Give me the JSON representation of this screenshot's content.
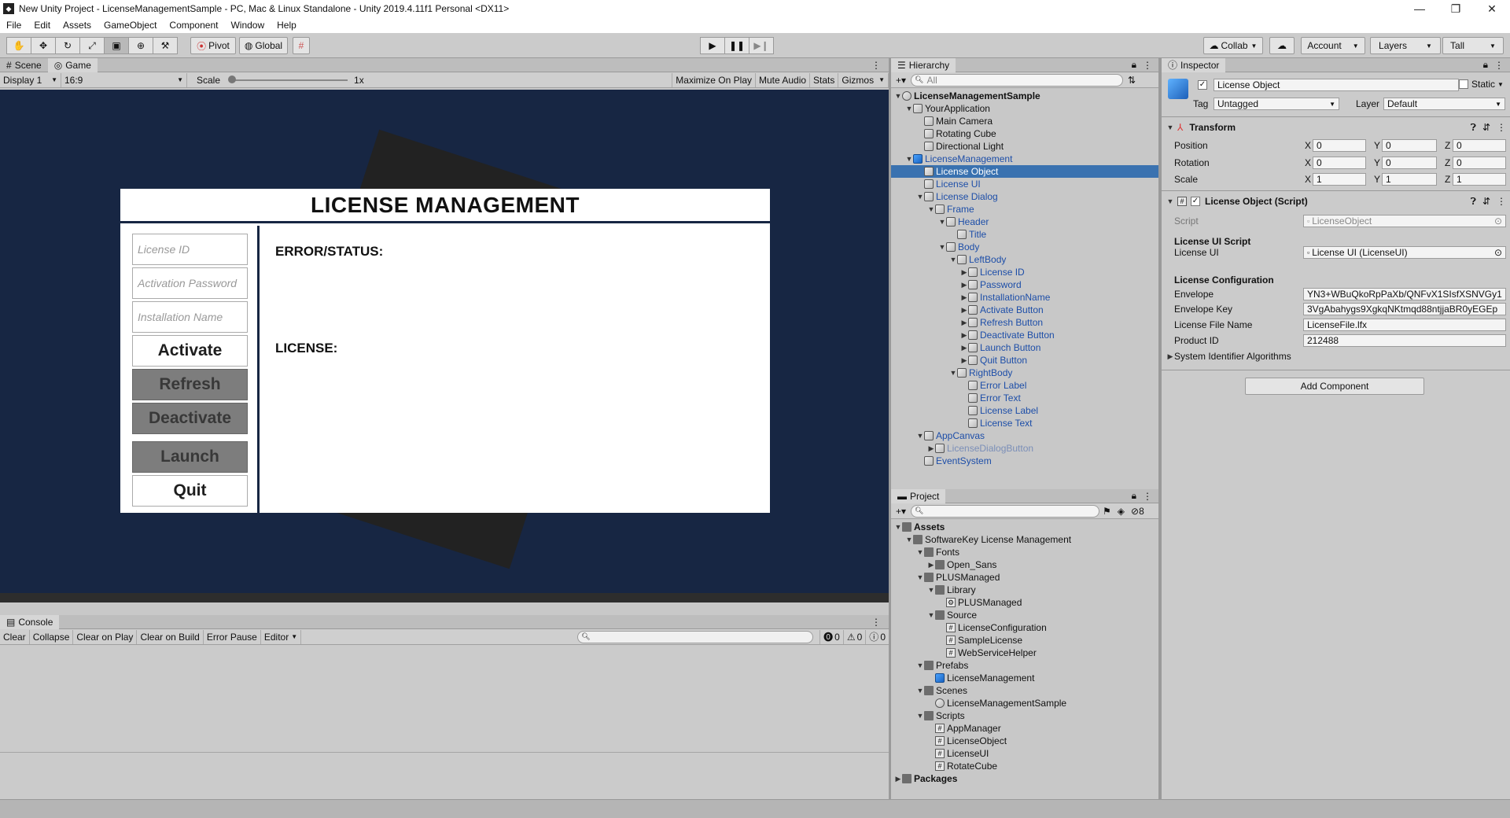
{
  "window": {
    "title": "New Unity Project - LicenseManagementSample - PC, Mac & Linux Standalone - Unity 2019.4.11f1 Personal <DX11>"
  },
  "menu": [
    "File",
    "Edit",
    "Assets",
    "GameObject",
    "Component",
    "Window",
    "Help"
  ],
  "toolbar": {
    "pivot": "Pivot",
    "global": "Global",
    "collab": "Collab",
    "account": "Account",
    "layers": "Layers",
    "layout": "Tall"
  },
  "scene_tabs": {
    "scene": "Scene",
    "game": "Game"
  },
  "game_bar": {
    "display": "Display 1",
    "aspect": "16:9",
    "scale_label": "Scale",
    "scale_value": "1x",
    "maximize": "Maximize On Play",
    "mute": "Mute Audio",
    "stats": "Stats",
    "gizmos": "Gizmos"
  },
  "dialog": {
    "title": "LICENSE MANAGEMENT",
    "license_id_placeholder": "License ID",
    "activation_password_placeholder": "Activation Password",
    "installation_name_placeholder": "Installation Name",
    "activate": "Activate",
    "refresh": "Refresh",
    "deactivate": "Deactivate",
    "launch": "Launch",
    "quit": "Quit",
    "error_label": "ERROR/STATUS:",
    "license_label": "LICENSE:"
  },
  "console": {
    "tab": "Console",
    "clear": "Clear",
    "collapse": "Collapse",
    "clear_on_play": "Clear on Play",
    "clear_on_build": "Clear on Build",
    "error_pause": "Error Pause",
    "editor": "Editor",
    "count_errors": "0",
    "count_warnings": "0",
    "count_info": "0"
  },
  "hierarchy": {
    "tab": "Hierarchy",
    "search": "All",
    "items": [
      {
        "label": "LicenseManagementSample",
        "depth": 0,
        "icon": "scene",
        "arrow": "down",
        "bold": true
      },
      {
        "label": "YourApplication",
        "depth": 1,
        "icon": "cube",
        "arrow": "down"
      },
      {
        "label": "Main Camera",
        "depth": 2,
        "icon": "cube"
      },
      {
        "label": "Rotating Cube",
        "depth": 2,
        "icon": "cube"
      },
      {
        "label": "Directional Light",
        "depth": 2,
        "icon": "cube"
      },
      {
        "label": "LicenseManagement",
        "depth": 1,
        "icon": "cube-blue",
        "arrow": "down",
        "blue": true
      },
      {
        "label": "License Object",
        "depth": 2,
        "icon": "cube",
        "selected": true
      },
      {
        "label": "License UI",
        "depth": 2,
        "icon": "cube",
        "blue": true
      },
      {
        "label": "License Dialog",
        "depth": 2,
        "icon": "cube",
        "arrow": "down",
        "blue": true
      },
      {
        "label": "Frame",
        "depth": 3,
        "icon": "cube",
        "arrow": "down",
        "blue": true
      },
      {
        "label": "Header",
        "depth": 4,
        "icon": "cube",
        "arrow": "down",
        "blue": true
      },
      {
        "label": "Title",
        "depth": 5,
        "icon": "cube",
        "blue": true
      },
      {
        "label": "Body",
        "depth": 4,
        "icon": "cube",
        "arrow": "down",
        "blue": true
      },
      {
        "label": "LeftBody",
        "depth": 5,
        "icon": "cube",
        "arrow": "down",
        "blue": true
      },
      {
        "label": "License ID",
        "depth": 6,
        "icon": "cube",
        "arrow": "right",
        "blue": true
      },
      {
        "label": "Password",
        "depth": 6,
        "icon": "cube",
        "arrow": "right",
        "blue": true
      },
      {
        "label": "InstallationName",
        "depth": 6,
        "icon": "cube",
        "arrow": "right",
        "blue": true
      },
      {
        "label": "Activate Button",
        "depth": 6,
        "icon": "cube",
        "arrow": "right",
        "blue": true
      },
      {
        "label": "Refresh Button",
        "depth": 6,
        "icon": "cube",
        "arrow": "right",
        "blue": true
      },
      {
        "label": "Deactivate Button",
        "depth": 6,
        "icon": "cube",
        "arrow": "right",
        "blue": true
      },
      {
        "label": "Launch Button",
        "depth": 6,
        "icon": "cube",
        "arrow": "right",
        "blue": true
      },
      {
        "label": "Quit Button",
        "depth": 6,
        "icon": "cube",
        "arrow": "right",
        "blue": true
      },
      {
        "label": "RightBody",
        "depth": 5,
        "icon": "cube",
        "arrow": "down",
        "blue": true
      },
      {
        "label": "Error Label",
        "depth": 6,
        "icon": "cube",
        "blue": true
      },
      {
        "label": "Error Text",
        "depth": 6,
        "icon": "cube",
        "blue": true
      },
      {
        "label": "License Label",
        "depth": 6,
        "icon": "cube",
        "blue": true
      },
      {
        "label": "License Text",
        "depth": 6,
        "icon": "cube",
        "blue": true
      },
      {
        "label": "AppCanvas",
        "depth": 2,
        "icon": "cube",
        "arrow": "down",
        "blue": true
      },
      {
        "label": "LicenseDialogButton",
        "depth": 3,
        "icon": "cube",
        "arrow": "right",
        "faded": true
      },
      {
        "label": "EventSystem",
        "depth": 2,
        "icon": "cube",
        "blue": true
      }
    ]
  },
  "project": {
    "tab": "Project",
    "hidden_count": "8",
    "items": [
      {
        "label": "Assets",
        "depth": 0,
        "icon": "folder",
        "arrow": "down",
        "bold": true
      },
      {
        "label": "SoftwareKey License Management",
        "depth": 1,
        "icon": "folder",
        "arrow": "down"
      },
      {
        "label": "Fonts",
        "depth": 2,
        "icon": "folder",
        "arrow": "down"
      },
      {
        "label": "Open_Sans",
        "depth": 3,
        "icon": "folder",
        "arrow": "right"
      },
      {
        "label": "PLUSManaged",
        "depth": 2,
        "icon": "folder",
        "arrow": "down"
      },
      {
        "label": "Library",
        "depth": 3,
        "icon": "folder",
        "arrow": "down"
      },
      {
        "label": "PLUSManaged",
        "depth": 4,
        "icon": "dll"
      },
      {
        "label": "Source",
        "depth": 3,
        "icon": "folder",
        "arrow": "down"
      },
      {
        "label": "LicenseConfiguration",
        "depth": 4,
        "icon": "script"
      },
      {
        "label": "SampleLicense",
        "depth": 4,
        "icon": "script"
      },
      {
        "label": "WebServiceHelper",
        "depth": 4,
        "icon": "script"
      },
      {
        "label": "Prefabs",
        "depth": 2,
        "icon": "folder",
        "arrow": "down"
      },
      {
        "label": "LicenseManagement",
        "depth": 3,
        "icon": "cube-blue"
      },
      {
        "label": "Scenes",
        "depth": 2,
        "icon": "folder",
        "arrow": "down"
      },
      {
        "label": "LicenseManagementSample",
        "depth": 3,
        "icon": "scene"
      },
      {
        "label": "Scripts",
        "depth": 2,
        "icon": "folder",
        "arrow": "down"
      },
      {
        "label": "AppManager",
        "depth": 3,
        "icon": "script"
      },
      {
        "label": "LicenseObject",
        "depth": 3,
        "icon": "script"
      },
      {
        "label": "LicenseUI",
        "depth": 3,
        "icon": "script"
      },
      {
        "label": "RotateCube",
        "depth": 3,
        "icon": "script"
      },
      {
        "label": "Packages",
        "depth": 0,
        "icon": "folder",
        "arrow": "right",
        "bold": true
      }
    ]
  },
  "inspector": {
    "tab": "Inspector",
    "object_name": "License Object",
    "static": "Static",
    "tag_label": "Tag",
    "tag_value": "Untagged",
    "layer_label": "Layer",
    "layer_value": "Default",
    "transform": {
      "title": "Transform",
      "position": "Position",
      "rotation": "Rotation",
      "scale": "Scale",
      "pos": [
        "0",
        "0",
        "0"
      ],
      "rot": [
        "0",
        "0",
        "0"
      ],
      "scl": [
        "1",
        "1",
        "1"
      ]
    },
    "script": {
      "title": "License Object (Script)",
      "script_label": "Script",
      "script_value": "LicenseObject",
      "ui_header": "License UI Script",
      "license_ui_label": "License UI",
      "license_ui_value": "License UI (LicenseUI)",
      "config_header": "License Configuration",
      "envelope_label": "Envelope",
      "envelope_value": "YN3+WBuQkoRpPaXb/QNFvX1SIsfXSNVGy1",
      "envelope_key_label": "Envelope Key",
      "envelope_key_value": "3VgAbahygs9XgkqNKtmqd88ntjjaBR0yEGEp",
      "file_label": "License File Name",
      "file_value": "LicenseFile.lfx",
      "product_label": "Product ID",
      "product_value": "212488",
      "algos": "System Identifier Algorithms"
    },
    "add_component": "Add Component"
  }
}
